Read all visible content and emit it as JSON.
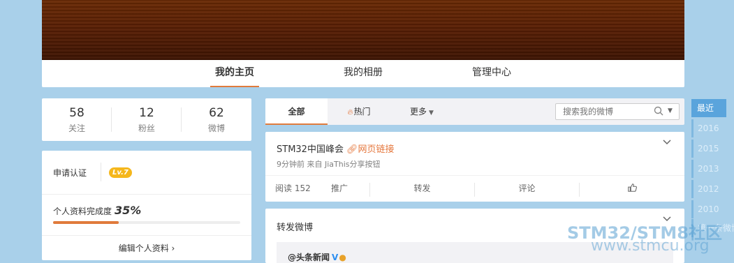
{
  "nav": {
    "tabs": [
      {
        "label": "我的主页",
        "active": true
      },
      {
        "label": "我的相册",
        "active": false
      },
      {
        "label": "管理中心",
        "active": false
      }
    ]
  },
  "stats": [
    {
      "value": "58",
      "label": "关注"
    },
    {
      "value": "12",
      "label": "粉丝"
    },
    {
      "value": "62",
      "label": "微博"
    }
  ],
  "profile": {
    "verify_label": "申请认证",
    "level": "Lv.7",
    "completion_label": "个人资料完成度",
    "completion_pct": "35%",
    "completion_value": 0.35,
    "edit_label": "编辑个人资料 ›"
  },
  "feed_nav": {
    "all": "全部",
    "hot": "热门",
    "more": "更多",
    "search_placeholder": "搜索我的微博"
  },
  "post1": {
    "title": "STM32中国峰会",
    "link": "网页链接",
    "meta": "9分钟前 来自 JiaThis分享按钮",
    "read_label": "阅读 152",
    "promote": "推广",
    "repost": "转发",
    "comment": "评论"
  },
  "post2": {
    "title": "转发微博",
    "quote_user": "@头条新闻",
    "verified_mark": "V"
  },
  "timeline": [
    "最近",
    "2016",
    "2015",
    "2013",
    "2012",
    "2010",
    "第一条微博"
  ],
  "watermark": {
    "line1": "STM32/STM8社区",
    "line2": "www.stmcu.org"
  },
  "colors": {
    "accent": "#e07b3c",
    "background": "#a9d0ea",
    "level_badge": "#f5b71c",
    "timeline_active": "#5aa4dc"
  }
}
